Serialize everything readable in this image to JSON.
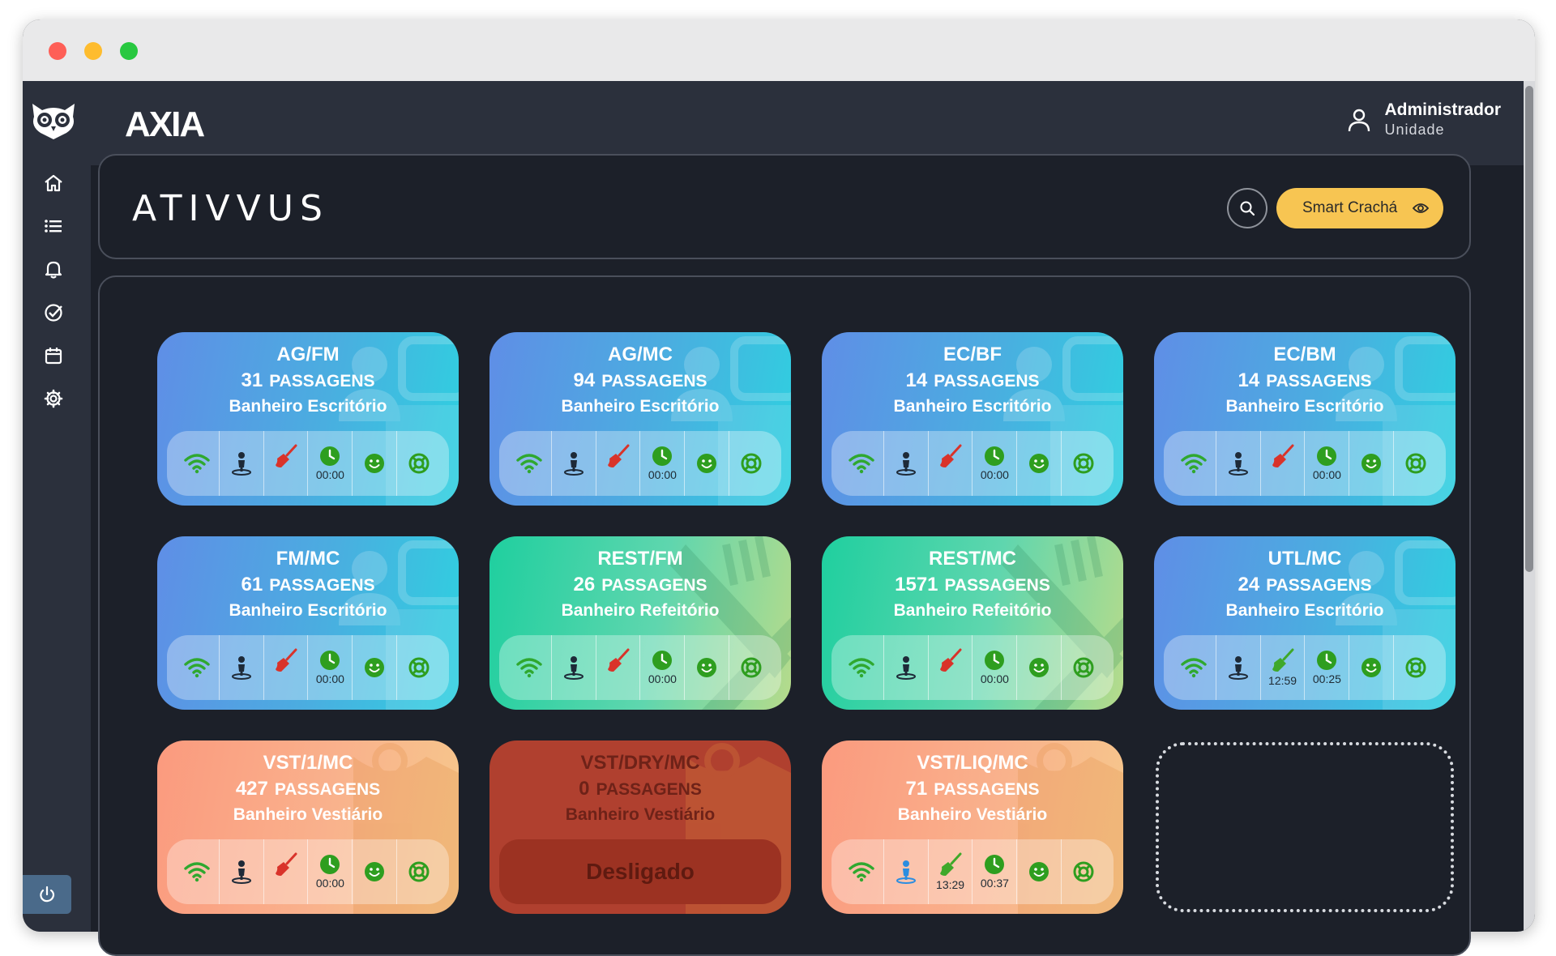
{
  "window": {
    "controls": [
      "close",
      "minimize",
      "maximize"
    ]
  },
  "sidebar": {
    "logo_icon": "owl-icon",
    "items": [
      {
        "icon": "home-icon",
        "name": "home"
      },
      {
        "icon": "list-icon",
        "name": "list"
      },
      {
        "icon": "bell-icon",
        "name": "alerts"
      },
      {
        "icon": "check-circle-icon",
        "name": "tasks"
      },
      {
        "icon": "calendar-icon",
        "name": "calendar"
      },
      {
        "icon": "gear-icon",
        "name": "settings"
      }
    ],
    "power_icon": "power-icon"
  },
  "topbar": {
    "brand": "AXIA",
    "user_name": "Administrador",
    "user_role": "Unidade"
  },
  "header": {
    "title": "ATIVVUS",
    "smart_label": "Smart Crachá"
  },
  "colors": {
    "accent": "#f7c552",
    "blue_card": "#4aaee0",
    "green_card": "#5fd6ae",
    "orange_card": "#f9b18c",
    "off_card": "#b0402f",
    "wifi_ok": "#2fa82f",
    "broom_alert": "#d9332a",
    "clock_ok": "#2e9e1f"
  },
  "cards": [
    {
      "title": "AG/FM",
      "count": "31",
      "pass_label": "PASSAGENS",
      "location": "Banheiro Escritório",
      "theme": "blue",
      "clean_time": "",
      "clock_time": "00:00",
      "broom": "red",
      "person": "dark"
    },
    {
      "title": "AG/MC",
      "count": "94",
      "pass_label": "PASSAGENS",
      "location": "Banheiro Escritório",
      "theme": "blue",
      "clean_time": "",
      "clock_time": "00:00",
      "broom": "red",
      "person": "dark"
    },
    {
      "title": "EC/BF",
      "count": "14",
      "pass_label": "PASSAGENS",
      "location": "Banheiro Escritório",
      "theme": "blue",
      "clean_time": "",
      "clock_time": "00:00",
      "broom": "red",
      "person": "dark"
    },
    {
      "title": "EC/BM",
      "count": "14",
      "pass_label": "PASSAGENS",
      "location": "Banheiro Escritório",
      "theme": "blue",
      "clean_time": "",
      "clock_time": "00:00",
      "broom": "red",
      "person": "dark"
    },
    {
      "title": "FM/MC",
      "count": "61",
      "pass_label": "PASSAGENS",
      "location": "Banheiro Escritório",
      "theme": "blue",
      "clean_time": "",
      "clock_time": "00:00",
      "broom": "red",
      "person": "dark"
    },
    {
      "title": "REST/FM",
      "count": "26",
      "pass_label": "PASSAGENS",
      "location": "Banheiro Refeitório",
      "theme": "green",
      "clean_time": "",
      "clock_time": "00:00",
      "broom": "red",
      "person": "dark"
    },
    {
      "title": "REST/MC",
      "count": "1571",
      "pass_label": "PASSAGENS",
      "location": "Banheiro Refeitório",
      "theme": "green",
      "clean_time": "",
      "clock_time": "00:00",
      "broom": "red",
      "person": "dark"
    },
    {
      "title": "UTL/MC",
      "count": "24",
      "pass_label": "PASSAGENS",
      "location": "Banheiro Escritório",
      "theme": "blue",
      "clean_time": "12:59",
      "clock_time": "00:25",
      "broom": "green",
      "person": "dark"
    },
    {
      "title": "VST/1/MC",
      "count": "427",
      "pass_label": "PASSAGENS",
      "location": "Banheiro Vestiário",
      "theme": "orange",
      "clean_time": "",
      "clock_time": "00:00",
      "broom": "red",
      "person": "dark"
    },
    {
      "title": "VST/DRY/MC",
      "count": "0",
      "pass_label": "PASSAGENS",
      "location": "Banheiro Vestiário",
      "theme": "red",
      "off_label": "Desligado"
    },
    {
      "title": "VST/LIQ/MC",
      "count": "71",
      "pass_label": "PASSAGENS",
      "location": "Banheiro Vestiário",
      "theme": "orange",
      "clean_time": "13:29",
      "clock_time": "00:37",
      "broom": "green",
      "person": "blue"
    }
  ]
}
